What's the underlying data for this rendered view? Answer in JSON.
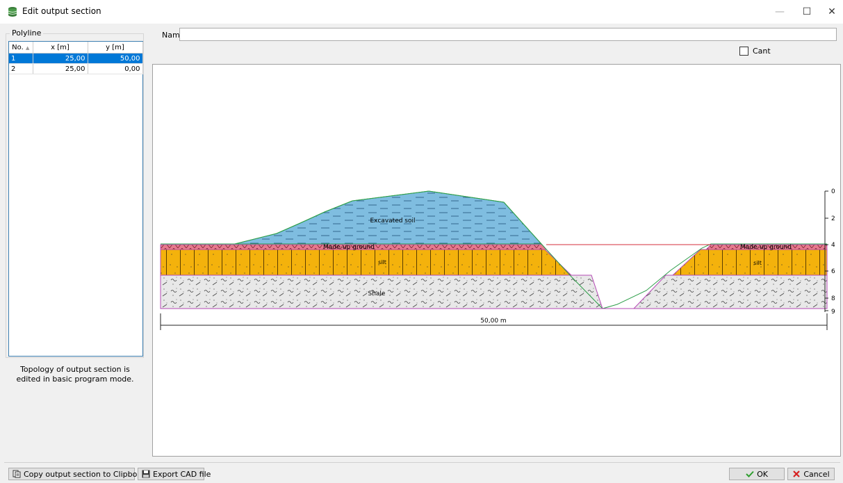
{
  "window": {
    "title": "Edit output section",
    "minimize": "—",
    "maximize": "☐",
    "close": "✕"
  },
  "polyline": {
    "legend": "Polyline",
    "columns": [
      "No.",
      "x [m]",
      "y [m]"
    ],
    "sort_indicator": "▲",
    "rows": [
      {
        "no": "1",
        "x": "25,00",
        "y": "50,00",
        "selected": true
      },
      {
        "no": "2",
        "x": "25,00",
        "y": "0,00",
        "selected": false
      }
    ]
  },
  "note": "Topology of output section is edited in basic program mode.",
  "name_field": {
    "label": "Name :",
    "value": ""
  },
  "cant": {
    "label": "Cant",
    "checked": false
  },
  "section": {
    "labels": {
      "excavated": "Excavated soil",
      "madeup_left": "Made-up ground",
      "madeup_right": "Made-up ground",
      "silt": "silt",
      "silt_right": "silt",
      "shale": "Shale"
    },
    "dimension": "50,00 m",
    "depth_ticks": [
      "0",
      "2",
      "4",
      "6",
      "8",
      "9"
    ],
    "colors": {
      "excavated": "#7fbde0",
      "madeup": "#e67a8c",
      "silt": "#f4b20c",
      "shale": "#e8e8e8",
      "outline_green": "#2e9e4a",
      "outline_magenta": "#b548b5",
      "ref_line": "#d62e3b"
    }
  },
  "buttons": {
    "copy": "Copy output section to Clipboard",
    "export": "Export CAD file",
    "ok": "OK",
    "cancel": "Cancel"
  }
}
